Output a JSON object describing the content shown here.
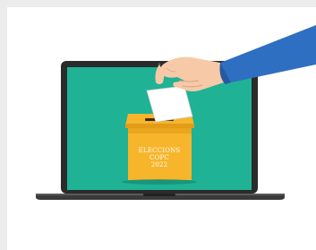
{
  "ballot_box": {
    "line1": "ELECCIONS",
    "line2": "COPC",
    "line3": "2022"
  },
  "colors": {
    "page_border": "#ececec",
    "canvas": "#ffffff",
    "screen": "#1fb295",
    "laptop_body": "#2b2b2b",
    "laptop_base": "#3a3a3a",
    "ballot_box": "#f6b52a",
    "ballot_box_shade": "#e39c17",
    "ballot_paper": "#ffffff",
    "sleeve": "#2f6fc1",
    "skin": "#f7c9a6"
  },
  "icons": [
    "laptop-icon",
    "ballot-box-icon",
    "ballot-paper-icon",
    "hand-icon"
  ]
}
